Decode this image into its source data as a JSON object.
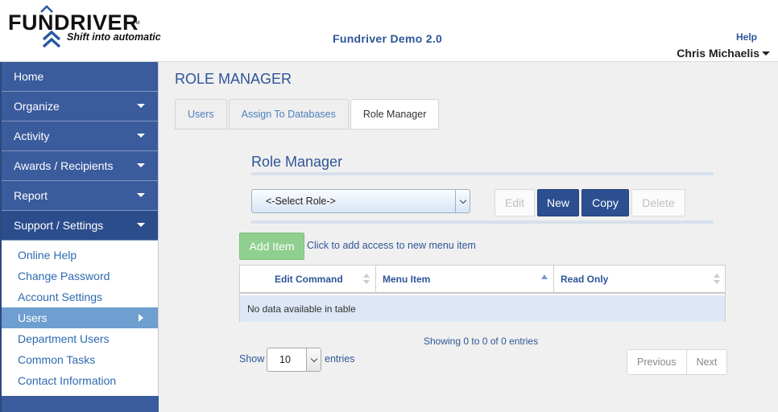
{
  "header": {
    "logo": {
      "wordmark": "FUNDRIVER",
      "trademark": "TM",
      "tagline": "Shift into automatic"
    },
    "app_title": "Fundriver Demo 2.0",
    "help": "Help",
    "user_name": "Chris Michaelis"
  },
  "sidebar": {
    "nav": [
      {
        "label": "Home",
        "has_caret": false
      },
      {
        "label": "Organize",
        "has_caret": true
      },
      {
        "label": "Activity",
        "has_caret": true
      },
      {
        "label": "Awards / Recipients",
        "has_caret": true
      },
      {
        "label": "Report",
        "has_caret": true
      },
      {
        "label": "Support / Settings",
        "has_caret": true,
        "active": true
      }
    ],
    "sub_items": [
      {
        "label": "Online Help"
      },
      {
        "label": "Change Password"
      },
      {
        "label": "Account Settings"
      },
      {
        "label": "Users",
        "active": true
      },
      {
        "label": "Department Users"
      },
      {
        "label": "Common Tasks"
      },
      {
        "label": "Contact Information"
      }
    ]
  },
  "main": {
    "page_heading": "ROLE MANAGER",
    "tabs": [
      {
        "label": "Users"
      },
      {
        "label": "Assign To Databases"
      },
      {
        "label": "Role Manager",
        "active": true
      }
    ],
    "section_title": "Role Manager",
    "role_select": {
      "value": "<-Select Role->"
    },
    "buttons": {
      "edit": "Edit",
      "new": "New",
      "copy": "Copy",
      "delete": "Delete"
    },
    "add_item": {
      "label": "Add Item",
      "hint": "Click to add access to new menu item"
    },
    "table": {
      "columns": [
        "Edit Command",
        "Menu Item",
        "Read Only"
      ],
      "empty_message": "No data available in table"
    },
    "info": "Showing 0 to 0 of 0 entries",
    "length": {
      "show": "Show",
      "value": "10",
      "entries": "entries"
    },
    "pager": {
      "previous": "Previous",
      "next": "Next"
    }
  },
  "colors": {
    "nav_bg": "#3a5b9c",
    "accent_text": "#2e5597",
    "primary_button": "#2c4f91",
    "add_button": "#8fcf8f",
    "active_sub_item": "#6f9ed1"
  }
}
